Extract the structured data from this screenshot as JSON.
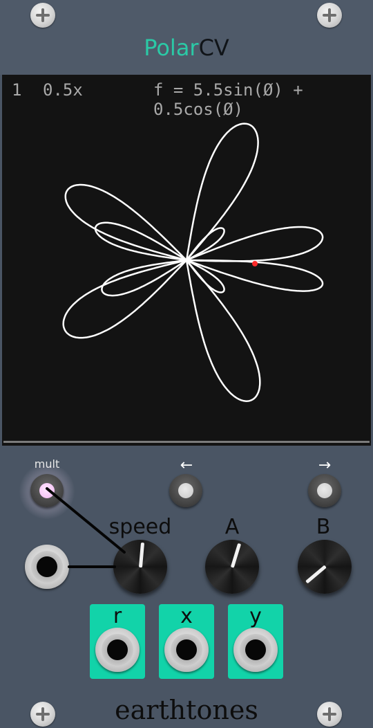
{
  "module": {
    "title_part1": "Polar",
    "title_part2": "CV",
    "brand": "earthtones"
  },
  "display": {
    "index": "1",
    "scale": "0.5x",
    "formula": "f = 5.5sin(Ø) + 0.5cos(Ø)",
    "curve_color": "#ffffff",
    "dot_color": "#ff2a2a",
    "background": "#131313"
  },
  "controls": {
    "mult_label": "mult",
    "prev_label": "←",
    "next_label": "→",
    "speed_label": "speed",
    "a_label": "A",
    "b_label": "B"
  },
  "knobs": {
    "speed_angle_deg": 5,
    "a_angle_deg": 17,
    "b_angle_deg": -130
  },
  "outputs": [
    "r",
    "x",
    "y"
  ],
  "colors": {
    "accent": "#12d3a9",
    "panel": "#4a5564",
    "mult_light": "#f2b7f2"
  }
}
